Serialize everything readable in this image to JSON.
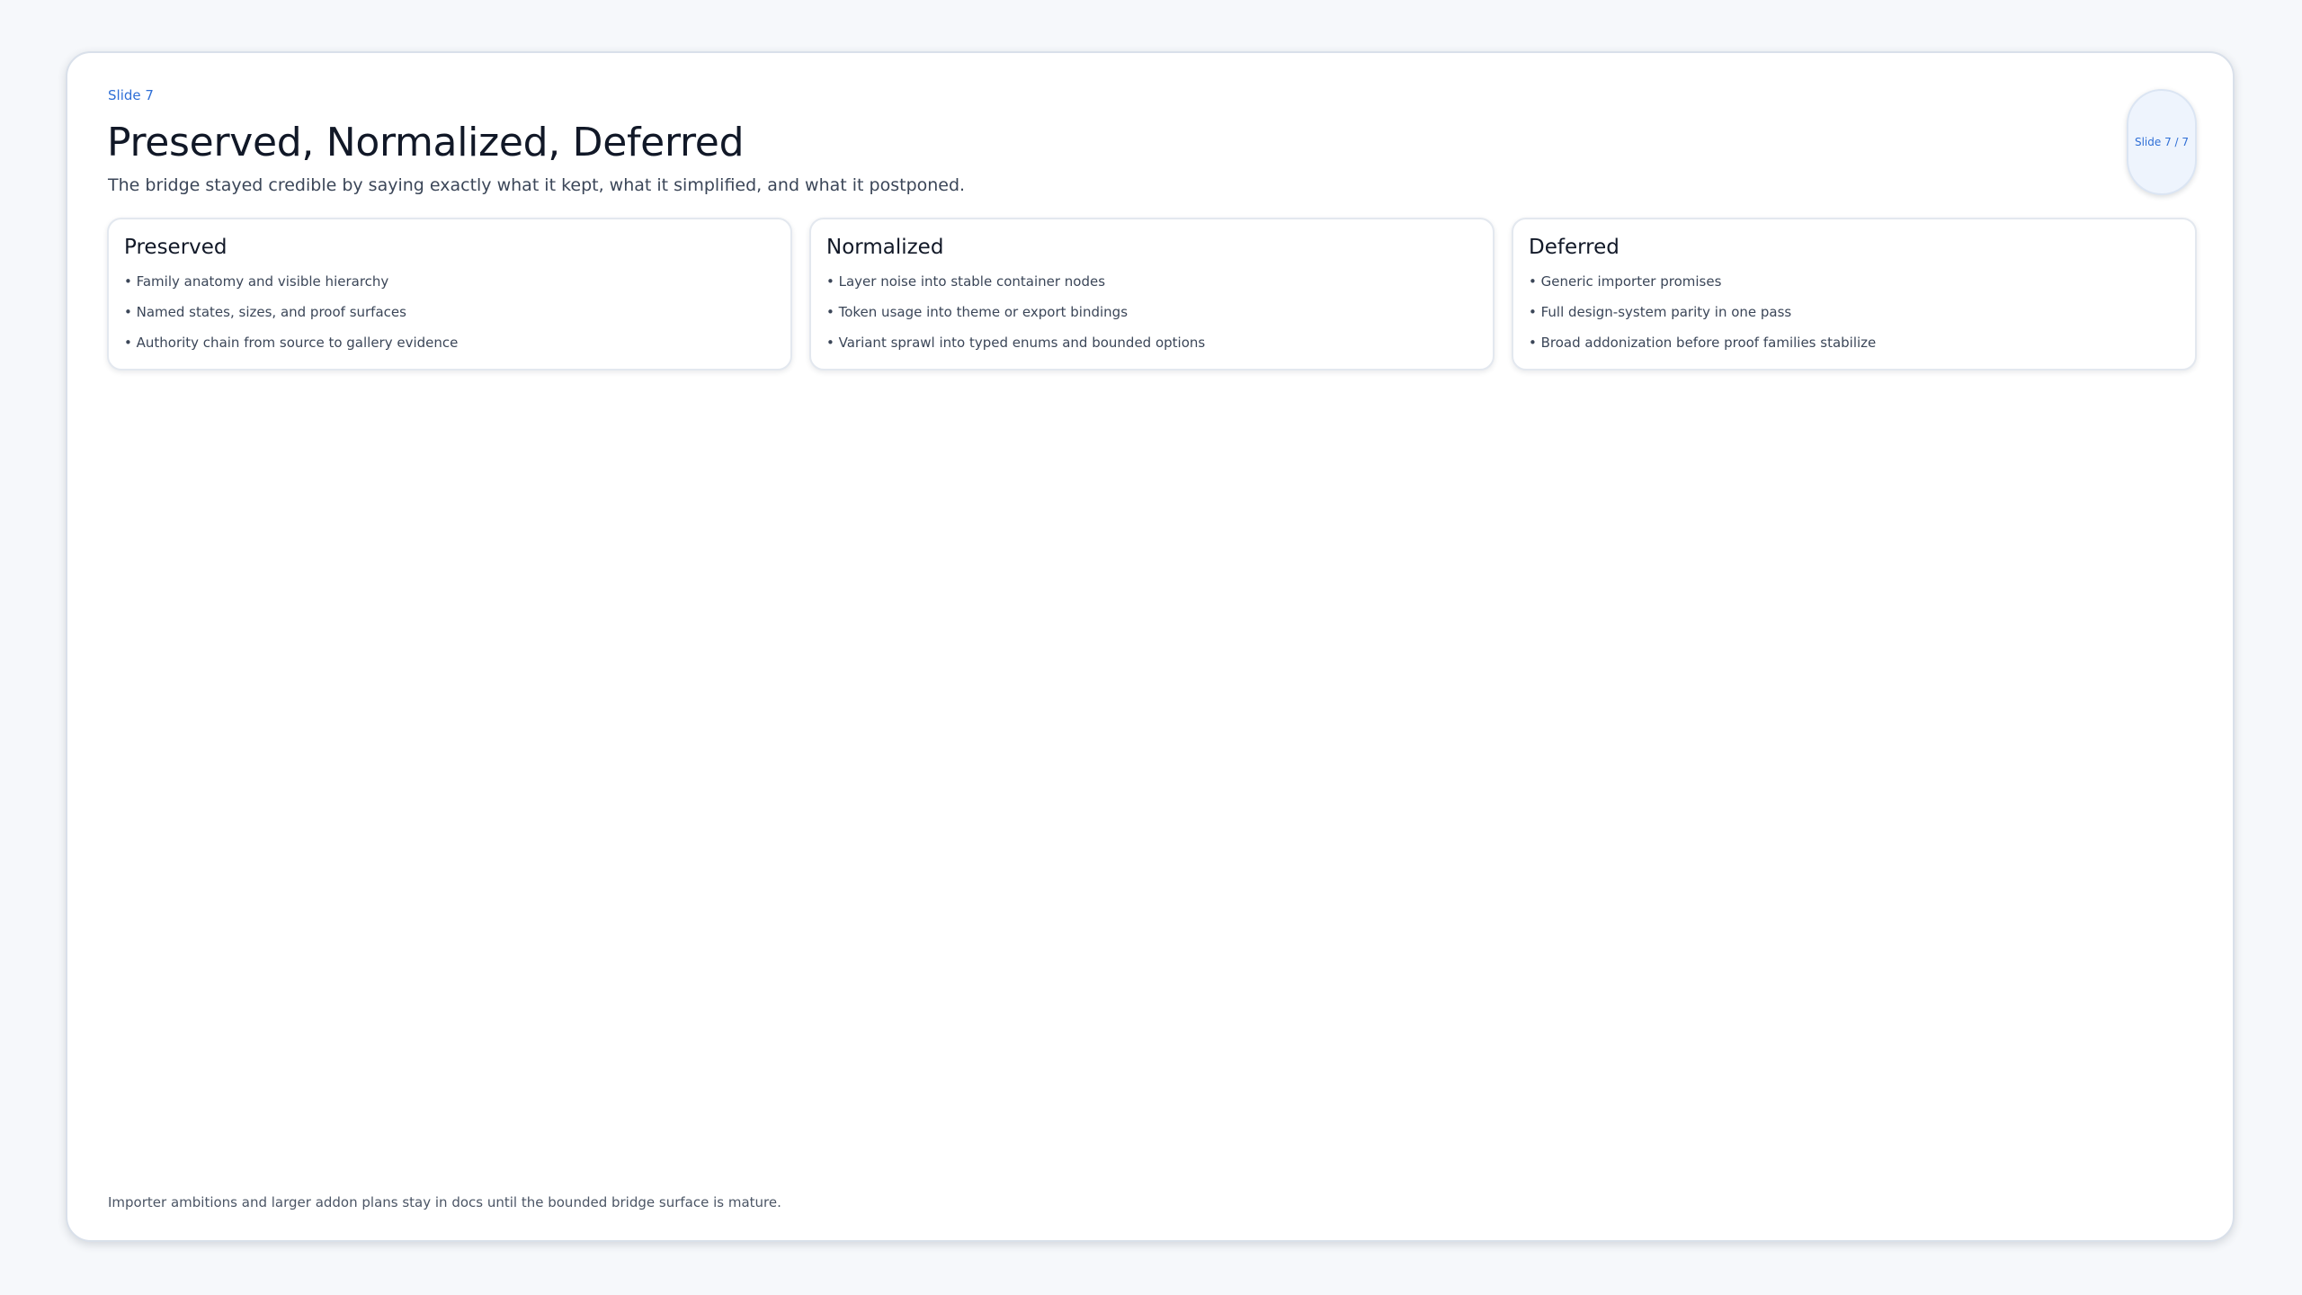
{
  "slide": {
    "eyebrow": "Slide 7",
    "title": "Preserved, Normalized, Deferred",
    "subtitle": "The bridge stayed credible by saying exactly what it kept, what it simplified, and what it postponed.",
    "counter": "Slide 7 / 7",
    "footnote": "Importer ambitions and larger addon plans stay in docs until the bounded bridge surface is mature."
  },
  "cards": [
    {
      "title": "Preserved",
      "items": [
        "• Family anatomy and visible hierarchy",
        "• Named states, sizes, and proof surfaces",
        "• Authority chain from source to gallery evidence"
      ]
    },
    {
      "title": "Normalized",
      "items": [
        "• Layer noise into stable container nodes",
        "• Token usage into theme or export bindings",
        "• Variant sprawl into typed enums and bounded options"
      ]
    },
    {
      "title": "Deferred",
      "items": [
        "• Generic importer promises",
        "• Full design-system parity in one pass",
        "• Broad addonization before proof families stabilize"
      ]
    }
  ],
  "colors": {
    "accent": "#2f6fd6",
    "heading": "#111827",
    "body": "#3b4658",
    "page_background": "#f6f8fb",
    "counter_background": "#eef4fd"
  }
}
